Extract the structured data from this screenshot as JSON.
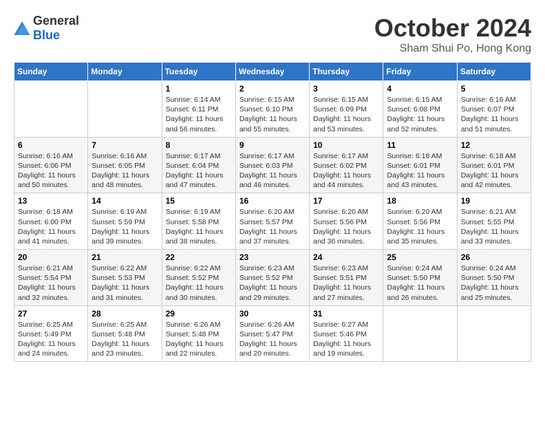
{
  "logo": {
    "text_general": "General",
    "text_blue": "Blue"
  },
  "title": "October 2024",
  "location": "Sham Shui Po, Hong Kong",
  "days_of_week": [
    "Sunday",
    "Monday",
    "Tuesday",
    "Wednesday",
    "Thursday",
    "Friday",
    "Saturday"
  ],
  "weeks": [
    [
      {
        "day": "",
        "sunrise": "",
        "sunset": "",
        "daylight": ""
      },
      {
        "day": "",
        "sunrise": "",
        "sunset": "",
        "daylight": ""
      },
      {
        "day": "1",
        "sunrise": "Sunrise: 6:14 AM",
        "sunset": "Sunset: 6:11 PM",
        "daylight": "Daylight: 11 hours and 56 minutes."
      },
      {
        "day": "2",
        "sunrise": "Sunrise: 6:15 AM",
        "sunset": "Sunset: 6:10 PM",
        "daylight": "Daylight: 11 hours and 55 minutes."
      },
      {
        "day": "3",
        "sunrise": "Sunrise: 6:15 AM",
        "sunset": "Sunset: 6:09 PM",
        "daylight": "Daylight: 11 hours and 53 minutes."
      },
      {
        "day": "4",
        "sunrise": "Sunrise: 6:15 AM",
        "sunset": "Sunset: 6:08 PM",
        "daylight": "Daylight: 11 hours and 52 minutes."
      },
      {
        "day": "5",
        "sunrise": "Sunrise: 6:16 AM",
        "sunset": "Sunset: 6:07 PM",
        "daylight": "Daylight: 11 hours and 51 minutes."
      }
    ],
    [
      {
        "day": "6",
        "sunrise": "Sunrise: 6:16 AM",
        "sunset": "Sunset: 6:06 PM",
        "daylight": "Daylight: 11 hours and 50 minutes."
      },
      {
        "day": "7",
        "sunrise": "Sunrise: 6:16 AM",
        "sunset": "Sunset: 6:05 PM",
        "daylight": "Daylight: 11 hours and 48 minutes."
      },
      {
        "day": "8",
        "sunrise": "Sunrise: 6:17 AM",
        "sunset": "Sunset: 6:04 PM",
        "daylight": "Daylight: 11 hours and 47 minutes."
      },
      {
        "day": "9",
        "sunrise": "Sunrise: 6:17 AM",
        "sunset": "Sunset: 6:03 PM",
        "daylight": "Daylight: 11 hours and 46 minutes."
      },
      {
        "day": "10",
        "sunrise": "Sunrise: 6:17 AM",
        "sunset": "Sunset: 6:02 PM",
        "daylight": "Daylight: 11 hours and 44 minutes."
      },
      {
        "day": "11",
        "sunrise": "Sunrise: 6:18 AM",
        "sunset": "Sunset: 6:01 PM",
        "daylight": "Daylight: 11 hours and 43 minutes."
      },
      {
        "day": "12",
        "sunrise": "Sunrise: 6:18 AM",
        "sunset": "Sunset: 6:01 PM",
        "daylight": "Daylight: 11 hours and 42 minutes."
      }
    ],
    [
      {
        "day": "13",
        "sunrise": "Sunrise: 6:18 AM",
        "sunset": "Sunset: 6:00 PM",
        "daylight": "Daylight: 11 hours and 41 minutes."
      },
      {
        "day": "14",
        "sunrise": "Sunrise: 6:19 AM",
        "sunset": "Sunset: 5:59 PM",
        "daylight": "Daylight: 11 hours and 39 minutes."
      },
      {
        "day": "15",
        "sunrise": "Sunrise: 6:19 AM",
        "sunset": "Sunset: 5:58 PM",
        "daylight": "Daylight: 11 hours and 38 minutes."
      },
      {
        "day": "16",
        "sunrise": "Sunrise: 6:20 AM",
        "sunset": "Sunset: 5:57 PM",
        "daylight": "Daylight: 11 hours and 37 minutes."
      },
      {
        "day": "17",
        "sunrise": "Sunrise: 6:20 AM",
        "sunset": "Sunset: 5:56 PM",
        "daylight": "Daylight: 11 hours and 36 minutes."
      },
      {
        "day": "18",
        "sunrise": "Sunrise: 6:20 AM",
        "sunset": "Sunset: 5:56 PM",
        "daylight": "Daylight: 11 hours and 35 minutes."
      },
      {
        "day": "19",
        "sunrise": "Sunrise: 6:21 AM",
        "sunset": "Sunset: 5:55 PM",
        "daylight": "Daylight: 11 hours and 33 minutes."
      }
    ],
    [
      {
        "day": "20",
        "sunrise": "Sunrise: 6:21 AM",
        "sunset": "Sunset: 5:54 PM",
        "daylight": "Daylight: 11 hours and 32 minutes."
      },
      {
        "day": "21",
        "sunrise": "Sunrise: 6:22 AM",
        "sunset": "Sunset: 5:53 PM",
        "daylight": "Daylight: 11 hours and 31 minutes."
      },
      {
        "day": "22",
        "sunrise": "Sunrise: 6:22 AM",
        "sunset": "Sunset: 5:52 PM",
        "daylight": "Daylight: 11 hours and 30 minutes."
      },
      {
        "day": "23",
        "sunrise": "Sunrise: 6:23 AM",
        "sunset": "Sunset: 5:52 PM",
        "daylight": "Daylight: 11 hours and 29 minutes."
      },
      {
        "day": "24",
        "sunrise": "Sunrise: 6:23 AM",
        "sunset": "Sunset: 5:51 PM",
        "daylight": "Daylight: 11 hours and 27 minutes."
      },
      {
        "day": "25",
        "sunrise": "Sunrise: 6:24 AM",
        "sunset": "Sunset: 5:50 PM",
        "daylight": "Daylight: 11 hours and 26 minutes."
      },
      {
        "day": "26",
        "sunrise": "Sunrise: 6:24 AM",
        "sunset": "Sunset: 5:50 PM",
        "daylight": "Daylight: 11 hours and 25 minutes."
      }
    ],
    [
      {
        "day": "27",
        "sunrise": "Sunrise: 6:25 AM",
        "sunset": "Sunset: 5:49 PM",
        "daylight": "Daylight: 11 hours and 24 minutes."
      },
      {
        "day": "28",
        "sunrise": "Sunrise: 6:25 AM",
        "sunset": "Sunset: 5:48 PM",
        "daylight": "Daylight: 11 hours and 23 minutes."
      },
      {
        "day": "29",
        "sunrise": "Sunrise: 6:26 AM",
        "sunset": "Sunset: 5:48 PM",
        "daylight": "Daylight: 11 hours and 22 minutes."
      },
      {
        "day": "30",
        "sunrise": "Sunrise: 6:26 AM",
        "sunset": "Sunset: 5:47 PM",
        "daylight": "Daylight: 11 hours and 20 minutes."
      },
      {
        "day": "31",
        "sunrise": "Sunrise: 6:27 AM",
        "sunset": "Sunset: 5:46 PM",
        "daylight": "Daylight: 11 hours and 19 minutes."
      },
      {
        "day": "",
        "sunrise": "",
        "sunset": "",
        "daylight": ""
      },
      {
        "day": "",
        "sunrise": "",
        "sunset": "",
        "daylight": ""
      }
    ]
  ]
}
